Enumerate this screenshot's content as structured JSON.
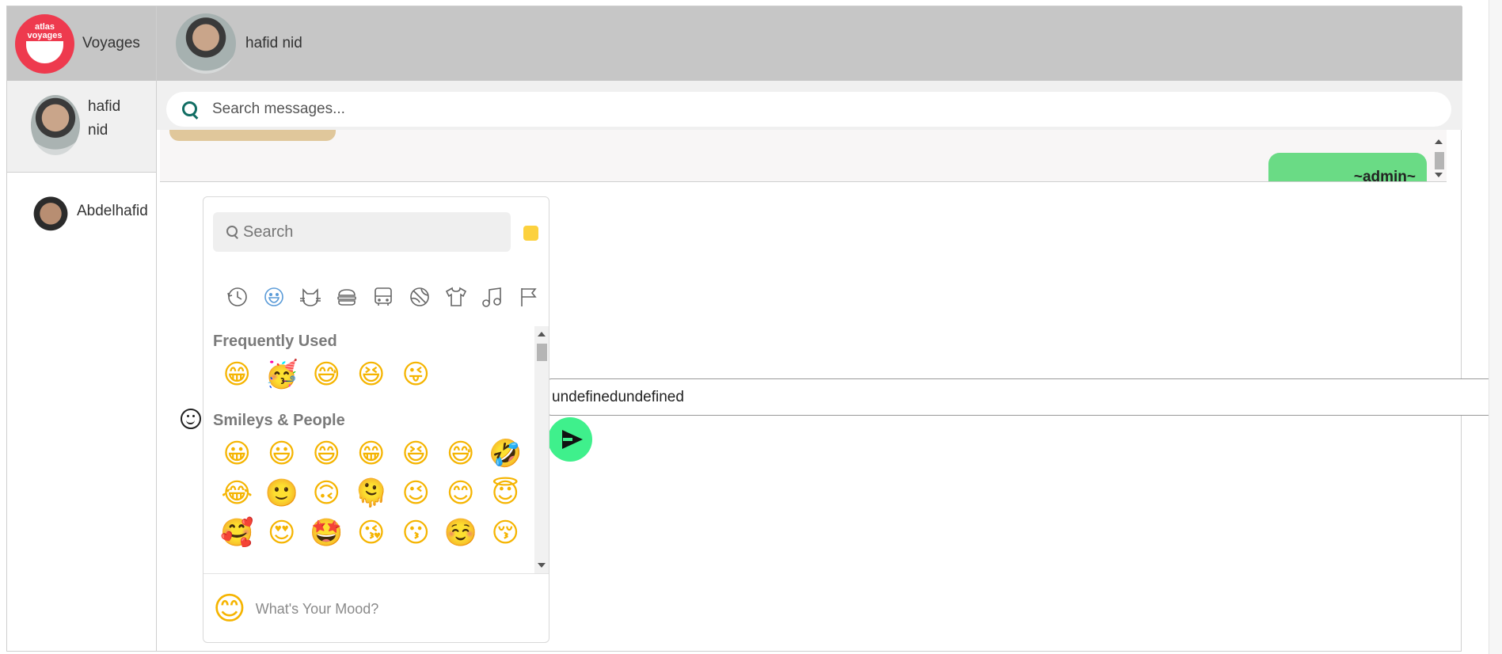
{
  "brand": {
    "logo_text": "atlas\nvoyages",
    "name": "Voyages"
  },
  "contacts": [
    {
      "name": "hafid nid",
      "active": true
    },
    {
      "name": "Abdelhafid",
      "active": false
    }
  ],
  "header": {
    "name": "hafid nid"
  },
  "search": {
    "placeholder": "Search messages..."
  },
  "messages": {
    "admin_label": "~admin~"
  },
  "composer": {
    "value": "undefinedundefined"
  },
  "emoji_picker": {
    "search_placeholder": "Search",
    "categories": [
      "clock-icon",
      "smiley-icon",
      "cat-icon",
      "burger-icon",
      "bus-icon",
      "ball-icon",
      "shirt-icon",
      "music-icon",
      "flag-icon"
    ],
    "frequently_used_heading": "Frequently Used",
    "frequently_used": [
      "😁",
      "🥳",
      "😅",
      "😆",
      "😜"
    ],
    "smileys_heading": "Smileys & People",
    "smileys_rows": [
      [
        "😀",
        "😃",
        "😄",
        "😁",
        "😆",
        "😅",
        "🤣"
      ],
      [
        "😂",
        "🙂",
        "🙃",
        "🫠",
        "😉",
        "😊",
        "😇"
      ],
      [
        "🥰",
        "😍",
        "🤩",
        "😘",
        "😗",
        "☺️",
        "😚"
      ]
    ],
    "preview_emoji": "😊",
    "preview_label": "What's Your Mood?",
    "skin_tone_color": "#fcd13e"
  },
  "colors": {
    "header_bg": "#c6c6c6",
    "accent_green": "#3ff08c",
    "admin_bubble": "#6adb85",
    "search_icon": "#116d63"
  }
}
